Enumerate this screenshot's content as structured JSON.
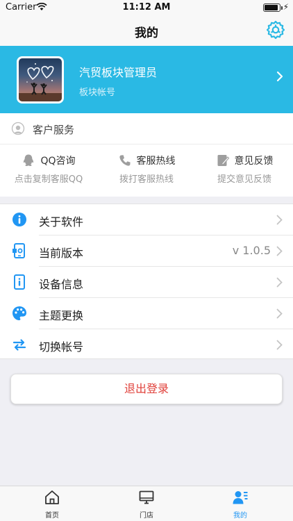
{
  "status_bar": {
    "carrier": "Carrier",
    "time": "11:12 AM",
    "battery_level": 0.92
  },
  "nav": {
    "title": "我的"
  },
  "profile": {
    "name": "汽贸板块管理员",
    "role": "板块帐号"
  },
  "customer_service": {
    "title": "客户服务",
    "items": [
      {
        "label": "QQ咨询",
        "sub": "点击复制客服QQ",
        "icon": "qq-penguin-icon"
      },
      {
        "label": "客服热线",
        "sub": "拨打客服热线",
        "icon": "phone-icon"
      },
      {
        "label": "意见反馈",
        "sub": "提交意见反馈",
        "icon": "feedback-edit-icon"
      }
    ]
  },
  "menu": [
    {
      "label": "关于软件",
      "value": "",
      "icon": "info-icon"
    },
    {
      "label": "当前版本",
      "value": "v 1.0.5",
      "icon": "version-phone-icon"
    },
    {
      "label": "设备信息",
      "value": "",
      "icon": "device-info-icon"
    },
    {
      "label": "主题更换",
      "value": "",
      "icon": "palette-icon"
    },
    {
      "label": "切换帐号",
      "value": "",
      "icon": "switch-arrows-icon"
    }
  ],
  "logout": {
    "label": "退出登录"
  },
  "tabs": [
    {
      "label": "首页",
      "icon": "home-icon",
      "active": false
    },
    {
      "label": "门店",
      "icon": "monitor-icon",
      "active": false
    },
    {
      "label": "我的",
      "icon": "user-list-icon",
      "active": true
    }
  ],
  "colors": {
    "accent": "#2ab9e4",
    "icon_blue": "#2196f3",
    "logout_red": "#e0403a"
  }
}
